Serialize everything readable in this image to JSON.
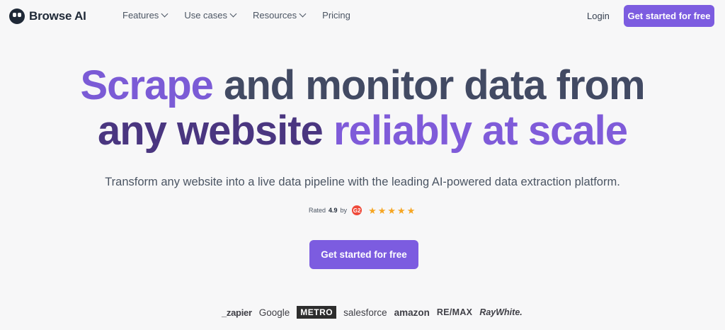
{
  "header": {
    "brand": "Browse AI",
    "nav": [
      {
        "label": "Features",
        "dropdown": true
      },
      {
        "label": "Use cases",
        "dropdown": true
      },
      {
        "label": "Resources",
        "dropdown": true
      },
      {
        "label": "Pricing",
        "dropdown": false
      }
    ],
    "login_label": "Login",
    "cta_label": "Get started for free"
  },
  "hero": {
    "line1_part1": "Scrape",
    "line1_part2": "and monitor data from",
    "line2_part1": "any website",
    "line2_part2": "reliably at scale",
    "subline": "Transform any website into a live data pipeline with the leading AI-powered data extraction platform.",
    "rating_prefix": "Rated",
    "rating_value": "4.9",
    "rating_by": "by",
    "rating_source_badge": "G2",
    "rating_stars": 5,
    "cta_label": "Get started for free"
  },
  "logos": [
    "_zapier",
    "Google",
    "METRO",
    "salesforce",
    "amazon",
    "RE/MAX",
    "RayWhite."
  ],
  "colors": {
    "accent": "#7c5ce0",
    "headline_purple": "#7b5bd6",
    "headline_dark": "#424a63",
    "star": "#f6a623",
    "g2_badge": "#ef4a3a"
  },
  "icons": [
    "browse-ai-logo-icon",
    "chevron-down-icon",
    "g2-icon",
    "star-icon"
  ]
}
